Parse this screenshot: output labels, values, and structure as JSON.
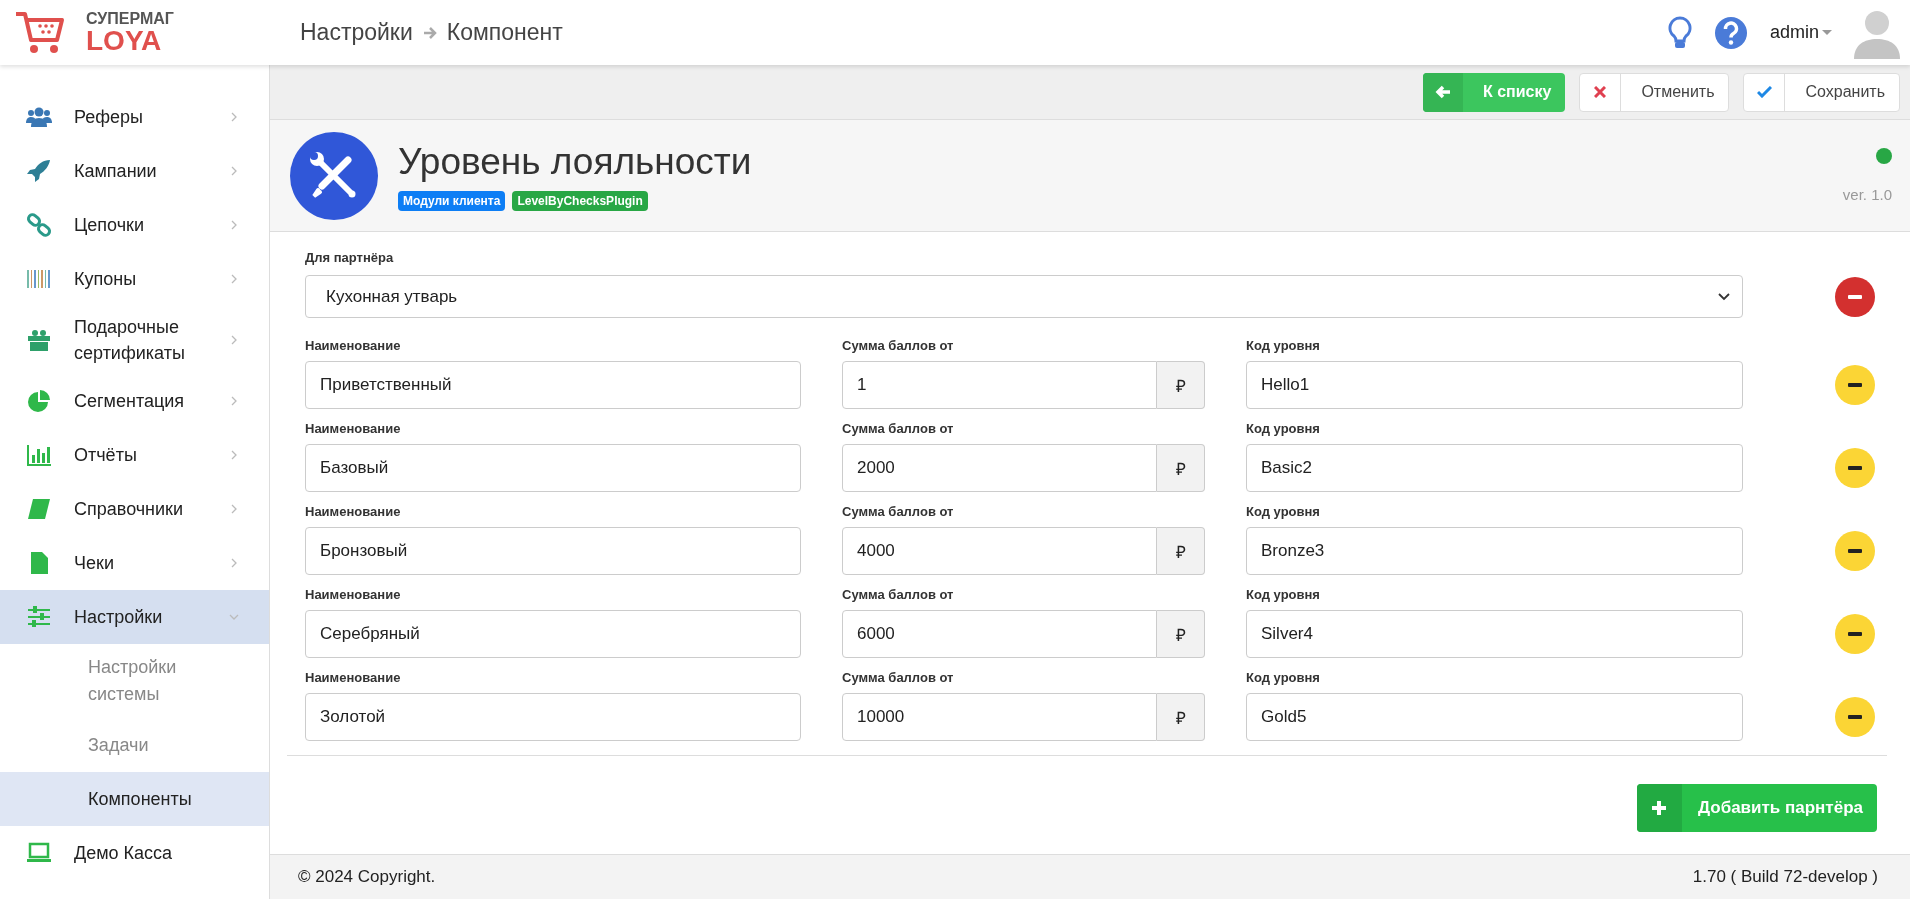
{
  "logo": {
    "line1": "СУПЕРМАГ",
    "line2": "LOYA"
  },
  "breadcrumb": [
    "Настройки",
    "Компонент"
  ],
  "user": {
    "name": "admin"
  },
  "sidebar": [
    {
      "label": "Реферы",
      "expandable": true,
      "expanded": false,
      "selected": false
    },
    {
      "label": "Кампании",
      "expandable": true,
      "expanded": false,
      "selected": false
    },
    {
      "label": "Цепочки",
      "expandable": true,
      "expanded": false,
      "selected": false
    },
    {
      "label": "Купоны",
      "expandable": true,
      "expanded": false,
      "selected": false
    },
    {
      "label": "Подарочные сертификаты",
      "expandable": true,
      "expanded": false,
      "selected": false
    },
    {
      "label": "Сегментация",
      "expandable": true,
      "expanded": false,
      "selected": false
    },
    {
      "label": "Отчёты",
      "expandable": true,
      "expanded": false,
      "selected": false
    },
    {
      "label": "Справочники",
      "expandable": true,
      "expanded": false,
      "selected": false
    },
    {
      "label": "Чеки",
      "expandable": true,
      "expanded": false,
      "selected": false
    },
    {
      "label": "Настройки",
      "expandable": true,
      "expanded": true,
      "selected": true,
      "children": [
        {
          "label": "Настройки системы",
          "selected": false
        },
        {
          "label": "Задачи",
          "selected": false
        },
        {
          "label": "Компоненты",
          "selected": true
        }
      ]
    },
    {
      "label": "Демо Касса",
      "expandable": false,
      "selected": false
    }
  ],
  "toolbar": [
    {
      "label": "К списку",
      "kind": "back"
    },
    {
      "label": "Отменить",
      "kind": "cancel"
    },
    {
      "label": "Сохранить",
      "kind": "save"
    }
  ],
  "component": {
    "title": "Уровень лояльности",
    "tags": [
      {
        "label": "Модули клиента",
        "color": "#0d7ef5"
      },
      {
        "label": "LevelByChecksPlugin",
        "color": "#28a745"
      }
    ],
    "active": true,
    "version": "ver. 1.0"
  },
  "partner": {
    "label": "Для партнёра",
    "value": "Кухонная утварь"
  },
  "levels": [
    {
      "name_label": "Наименование",
      "name": "Приветственный",
      "sum_label": "Сумма баллов от",
      "sum": "1",
      "currency": "₽",
      "code_label": "Код уровня",
      "code": "Hello1"
    },
    {
      "name_label": "Наименование",
      "name": "Базовый",
      "sum_label": "Сумма баллов от",
      "sum": "2000",
      "currency": "₽",
      "code_label": "Код уровня",
      "code": "Basic2"
    },
    {
      "name_label": "Наименование",
      "name": "Бронзовый",
      "sum_label": "Сумма баллов от",
      "sum": "4000",
      "currency": "₽",
      "code_label": "Код уровня",
      "code": "Bronze3"
    },
    {
      "name_label": "Наименование",
      "name": "Серебряный",
      "sum_label": "Сумма баллов от",
      "sum": "6000",
      "currency": "₽",
      "code_label": "Код уровня",
      "code": "Silver4"
    },
    {
      "name_label": "Наименование",
      "name": "Золотой",
      "sum_label": "Сумма баллов от",
      "sum": "10000",
      "currency": "₽",
      "code_label": "Код уровня",
      "code": "Gold5"
    }
  ],
  "add_button": "Добавить парнтёра",
  "footer": {
    "copyright": "© 2024 Copyright.",
    "build": "1.70 ( Build 72-develop )"
  }
}
